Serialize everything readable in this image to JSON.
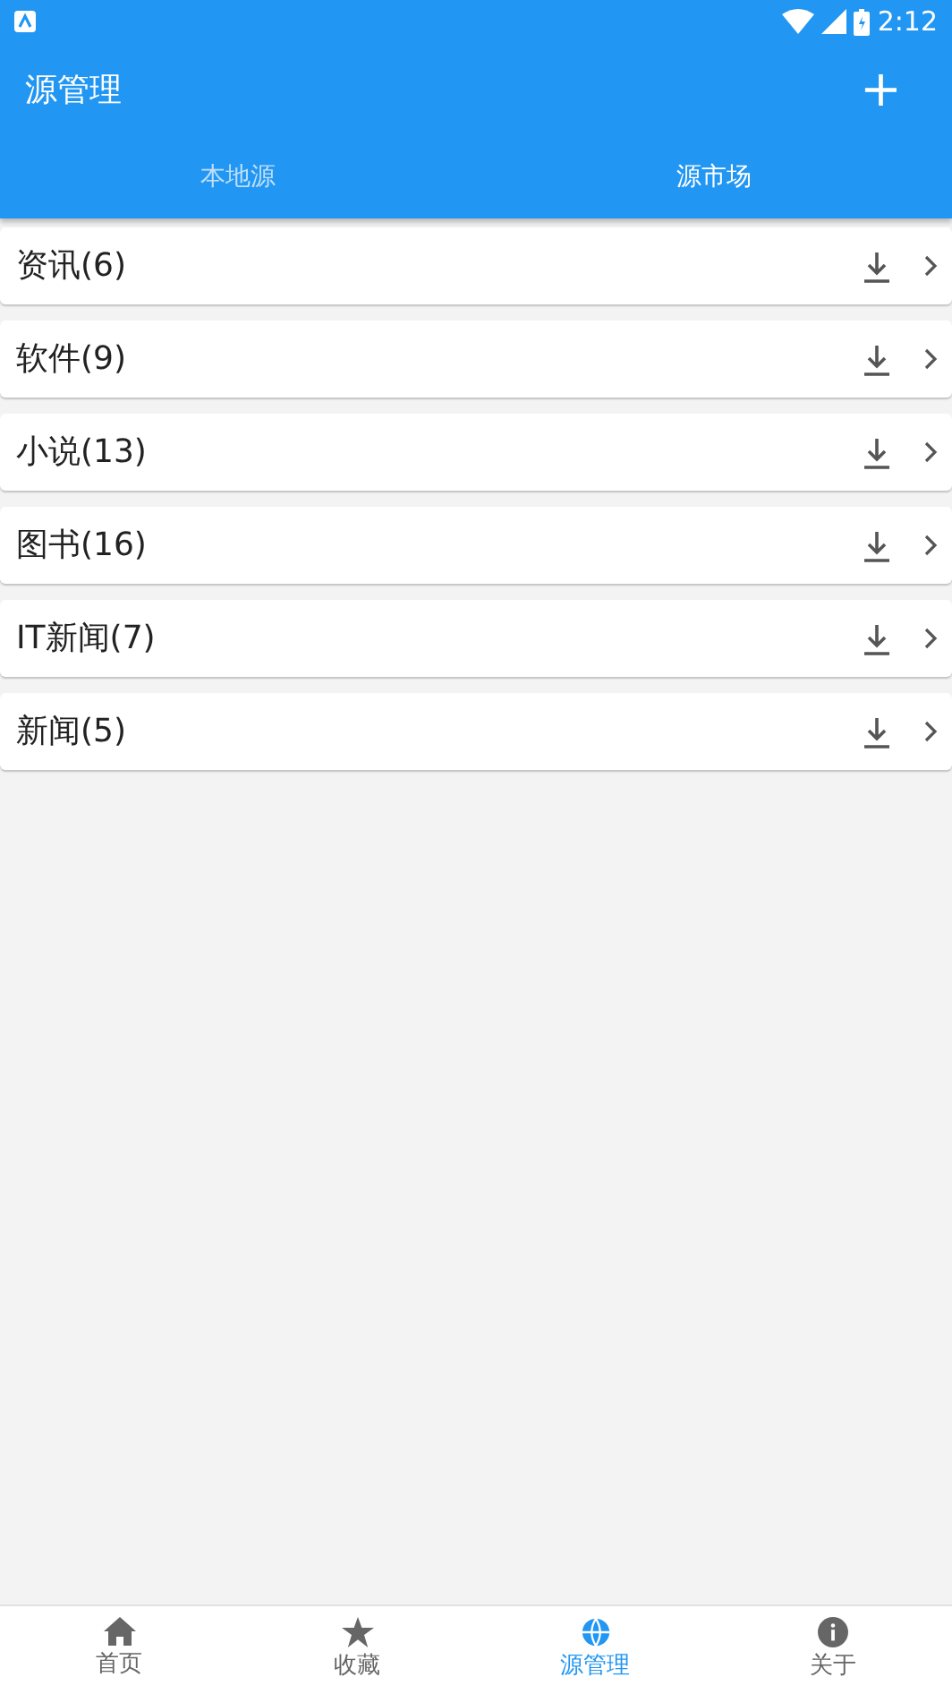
{
  "status_bar": {
    "time": "2:12"
  },
  "toolbar": {
    "title": "源管理",
    "add_label": "+"
  },
  "tabs": [
    {
      "label": "本地源",
      "selected": false
    },
    {
      "label": "源市场",
      "selected": true
    }
  ],
  "categories": [
    {
      "name": "资讯(6)"
    },
    {
      "name": "软件(9)"
    },
    {
      "name": "小说(13)"
    },
    {
      "name": "图书(16)"
    },
    {
      "name": "IT新闻(7)"
    },
    {
      "name": "新闻(5)"
    }
  ],
  "bottom_nav": [
    {
      "label": "首页",
      "selected": false
    },
    {
      "label": "收藏",
      "selected": false
    },
    {
      "label": "源管理",
      "selected": true
    },
    {
      "label": "关于",
      "selected": false
    }
  ]
}
